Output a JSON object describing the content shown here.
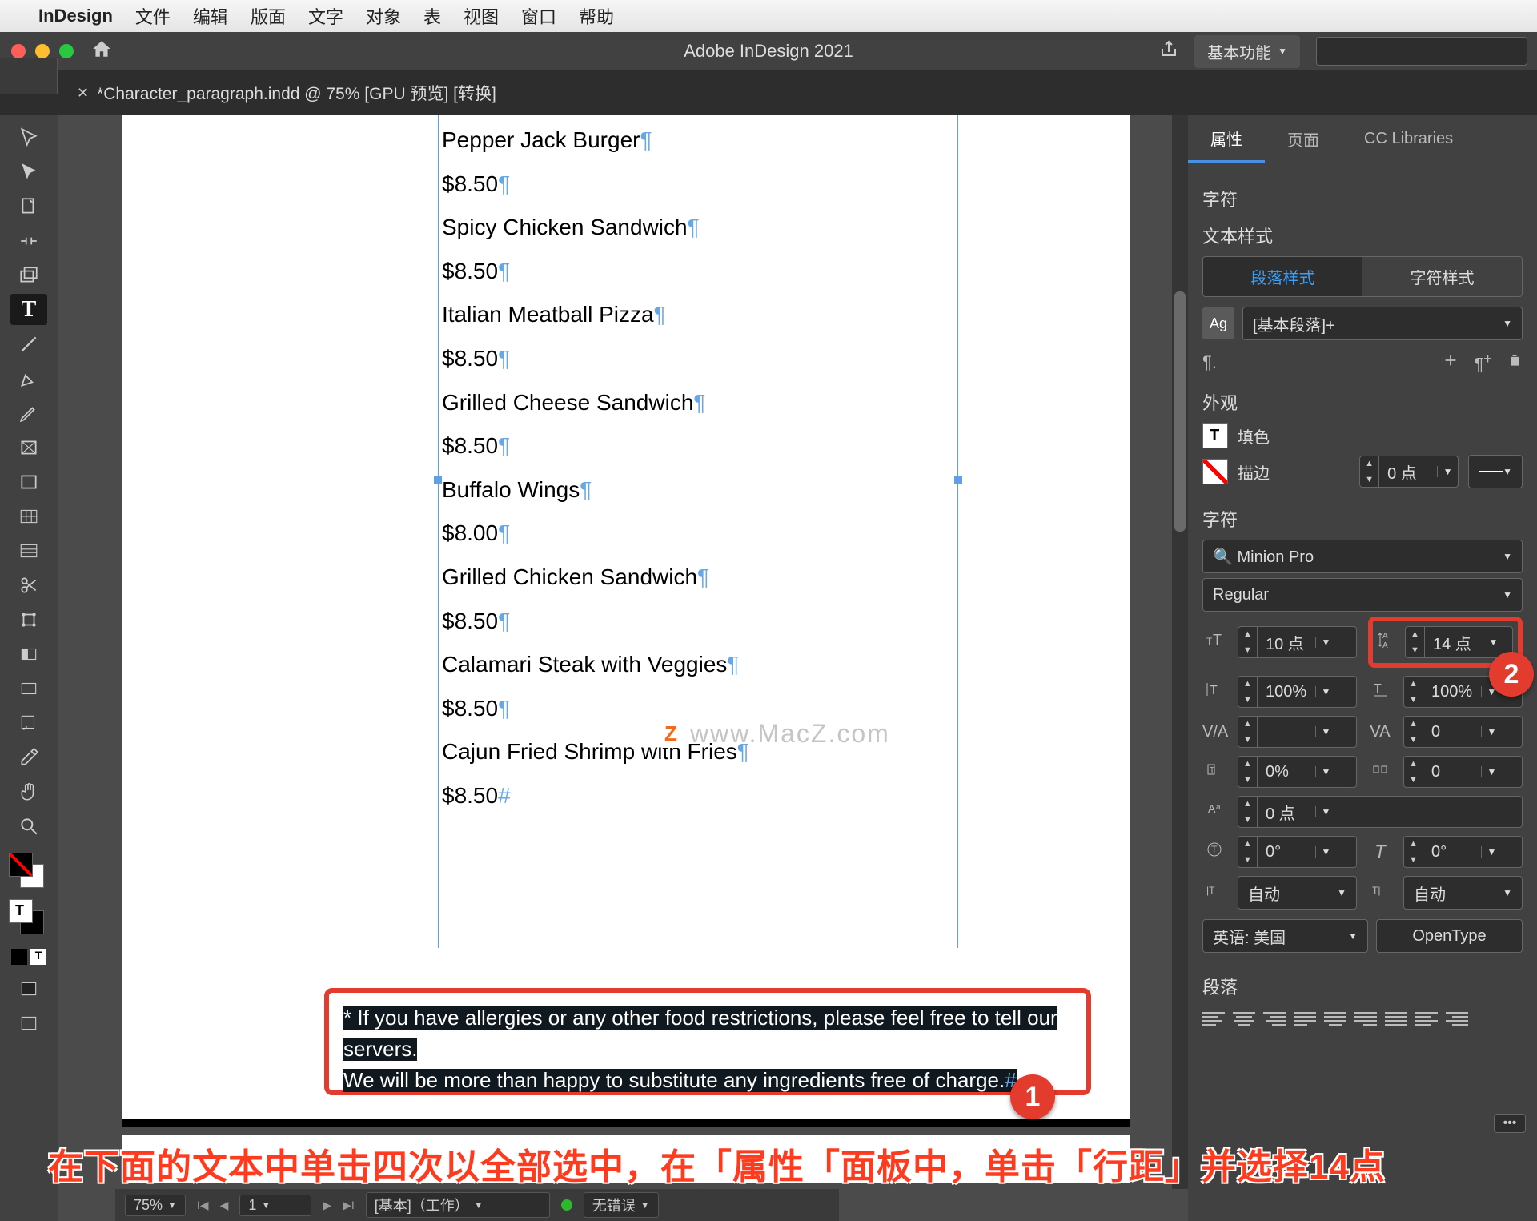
{
  "mac_menu": {
    "apple": "",
    "app": "InDesign",
    "items": [
      "文件",
      "编辑",
      "版面",
      "文字",
      "对象",
      "表",
      "视图",
      "窗口",
      "帮助"
    ]
  },
  "titlebar": {
    "app_title": "Adobe InDesign 2021",
    "workspace": "基本功能"
  },
  "doc_tab": {
    "label": "*Character_paragraph.indd @ 75% [GPU 预览] [转换]"
  },
  "document": {
    "lines": [
      "Pepper Jack Burger",
      "$8.50",
      "Spicy Chicken Sandwich",
      "$8.50",
      "Italian Meatball Pizza",
      "$8.50",
      "Grilled Cheese Sandwich",
      "$8.50",
      "Buffalo Wings",
      "$8.00",
      "Grilled Chicken Sandwich",
      "$8.50",
      "Calamari Steak with Veggies",
      "$8.50",
      "Cajun Fried Shrimp with Fries",
      "$8.50"
    ],
    "footnote_line1": "* If you have allergies or any other food restrictions, please feel free to tell our servers.",
    "footnote_line2": "We will be more than happy to substitute any ingredients free of charge."
  },
  "watermark": "www.MacZ.com",
  "callouts": {
    "one": "1",
    "two": "2"
  },
  "panel": {
    "tabs": {
      "properties": "属性",
      "pages": "页面",
      "cc": "CC Libraries"
    },
    "char_header": "字符",
    "text_style_header": "文本样式",
    "subtabs": {
      "para": "段落样式",
      "char": "字符样式"
    },
    "para_style": "[基本段落]+",
    "ag": "Ag",
    "pilcrow_menu": "¶.",
    "appearance_header": "外观",
    "fill": "填色",
    "stroke": "描边",
    "stroke_weight": "0 点",
    "char_section_header": "字符",
    "font_family": "Minion Pro",
    "font_style": "Regular",
    "font_size": "10 点",
    "leading": "14 点",
    "scale_v": "100%",
    "scale_h": "100%",
    "kerning": "",
    "tracking": "0",
    "baseline": "0%",
    "tsume": "0",
    "shift": "0 点",
    "rotation": "0°",
    "skew": "0°",
    "lang_auto1": "自动",
    "lang_auto2": "自动",
    "language": "英语: 美国",
    "opentype": "OpenType",
    "para_header": "段落"
  },
  "statusbar": {
    "zoom": "75%",
    "page_field": "1",
    "layer": "[基本]（工作）",
    "errors": "无错误"
  },
  "instruction": "在下面的文本中单击四次以全部选中，在「属性「面板中，单击「行距」并选择14点"
}
